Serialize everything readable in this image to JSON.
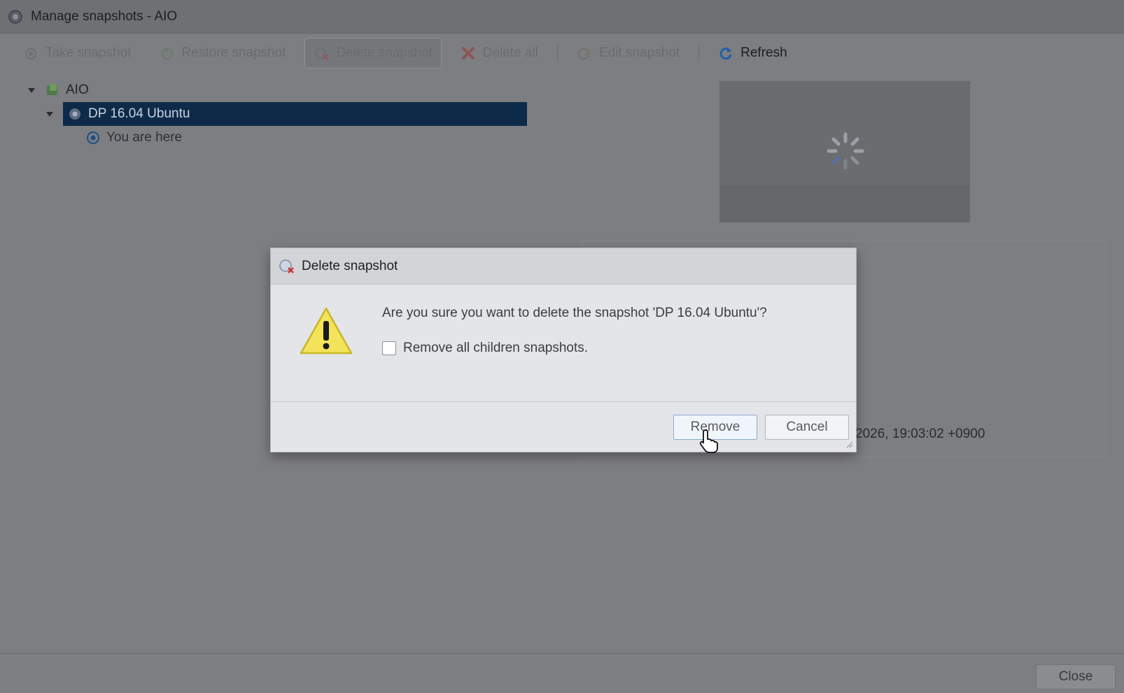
{
  "window": {
    "title": "Manage snapshots - AIO"
  },
  "toolbar": {
    "take_snapshot": "Take snapshot",
    "restore_snapshot": "Restore snapshot",
    "delete_snapshot": "Delete snapshot",
    "delete_all": "Delete all",
    "edit_snapshot": "Edit snapshot",
    "refresh": "Refresh"
  },
  "tree": {
    "root": "AIO",
    "snapshot": "DP 16.04 Ubuntu",
    "current": "You are here"
  },
  "details": {
    "date_fragment": "2026, 19:03:02 +0900"
  },
  "footer": {
    "close_label": "Close"
  },
  "dialog": {
    "title": "Delete snapshot",
    "message": "Are you sure you want to delete the snapshot 'DP 16.04 Ubuntu'?",
    "checkbox_label": "Remove all children snapshots.",
    "checkbox_checked": false,
    "remove_label": "Remove",
    "cancel_label": "Cancel"
  },
  "colors": {
    "selection": "#0e2a49",
    "overlay": "#7d7e82",
    "warning": "#f2e35a",
    "refresh_icon": "#1e5fa8"
  }
}
